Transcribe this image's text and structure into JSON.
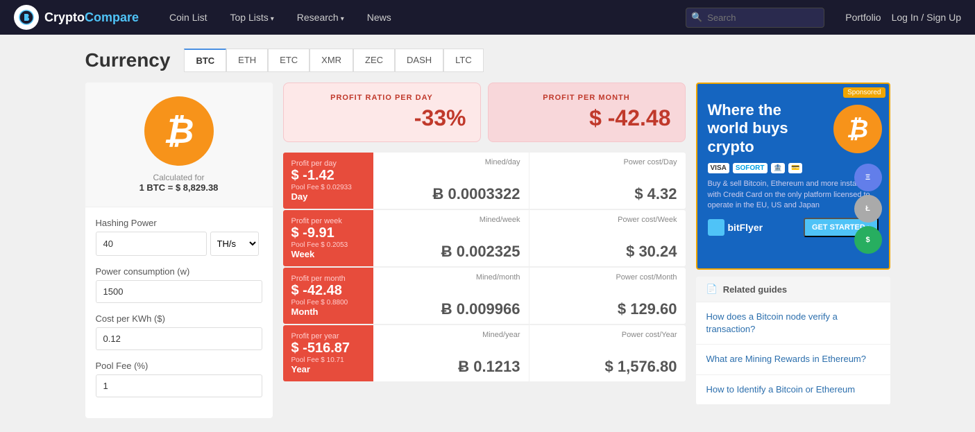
{
  "navbar": {
    "brand": "CryptoCompare",
    "brand_crypto": "Crypto",
    "brand_compare": "Compare",
    "nav_items": [
      {
        "label": "Coin List",
        "id": "coin-list",
        "has_dropdown": false
      },
      {
        "label": "Top Lists",
        "id": "top-lists",
        "has_dropdown": true
      },
      {
        "label": "Research",
        "id": "research",
        "has_dropdown": true
      },
      {
        "label": "News",
        "id": "news",
        "has_dropdown": false
      }
    ],
    "search_placeholder": "Search",
    "portfolio_label": "Portfolio",
    "login_label": "Log In / Sign Up"
  },
  "page": {
    "title": "Currency",
    "tabs": [
      {
        "label": "BTC",
        "active": true
      },
      {
        "label": "ETH",
        "active": false
      },
      {
        "label": "ETC",
        "active": false
      },
      {
        "label": "XMR",
        "active": false
      },
      {
        "label": "ZEC",
        "active": false
      },
      {
        "label": "DASH",
        "active": false
      },
      {
        "label": "LTC",
        "active": false
      }
    ]
  },
  "coin": {
    "calc_for": "Calculated for",
    "calc_value": "1 BTC = $ 8,829.38"
  },
  "form": {
    "hashing_power_label": "Hashing Power",
    "hashing_power_value": "40",
    "hashing_unit": "TH/s",
    "power_consumption_label": "Power consumption (w)",
    "power_value": "1500",
    "cost_per_kwh_label": "Cost per KWh ($)",
    "cost_value": "0.12",
    "pool_fee_label": "Pool Fee (%)",
    "pool_fee_value": "1"
  },
  "profit_summary": {
    "ratio_label": "PROFIT RATIO PER DAY",
    "ratio_value": "-33%",
    "month_label": "PROFIT PER MONTH",
    "month_value": "$ -42.48"
  },
  "rows": [
    {
      "period": "Day",
      "profit_label": "Profit per day",
      "profit_value": "$ -1.42",
      "fee_label": "Pool Fee $ 0.02933",
      "mined_label": "Mined/day",
      "mined_value": "Ƀ 0.0003322",
      "power_label": "Power cost/Day",
      "power_value": "$ 4.32"
    },
    {
      "period": "Week",
      "profit_label": "Profit per week",
      "profit_value": "$ -9.91",
      "fee_label": "Pool Fee $ 0.2053",
      "mined_label": "Mined/week",
      "mined_value": "Ƀ 0.002325",
      "power_label": "Power cost/Week",
      "power_value": "$ 30.24"
    },
    {
      "period": "Month",
      "profit_label": "Profit per month",
      "profit_value": "$ -42.48",
      "fee_label": "Pool Fee $ 0.8800",
      "mined_label": "Mined/month",
      "mined_value": "Ƀ 0.009966",
      "power_label": "Power cost/Month",
      "power_value": "$ 129.60"
    },
    {
      "period": "Year",
      "profit_label": "Profit per year",
      "profit_value": "$ -516.87",
      "fee_label": "Pool Fee $ 10.71",
      "mined_label": "Mined/year",
      "mined_value": "Ƀ 0.1213",
      "power_label": "Power cost/Year",
      "power_value": "$ 1,576.80"
    }
  ],
  "ad": {
    "sponsored": "Sponsored",
    "headline": "Where the world buys crypto",
    "description": "Buy & sell Bitcoin, Ethereum and more instantly with Credit Card on the only platform licensed to operate in the EU, US and Japan",
    "cta": "GET STARTED ›",
    "brand": "bitFlyer"
  },
  "related_guides": {
    "header": "Related guides",
    "items": [
      "How does a Bitcoin node verify a transaction?",
      "What are Mining Rewards in Ethereum?",
      "How to Identify a Bitcoin or Ethereum"
    ]
  }
}
